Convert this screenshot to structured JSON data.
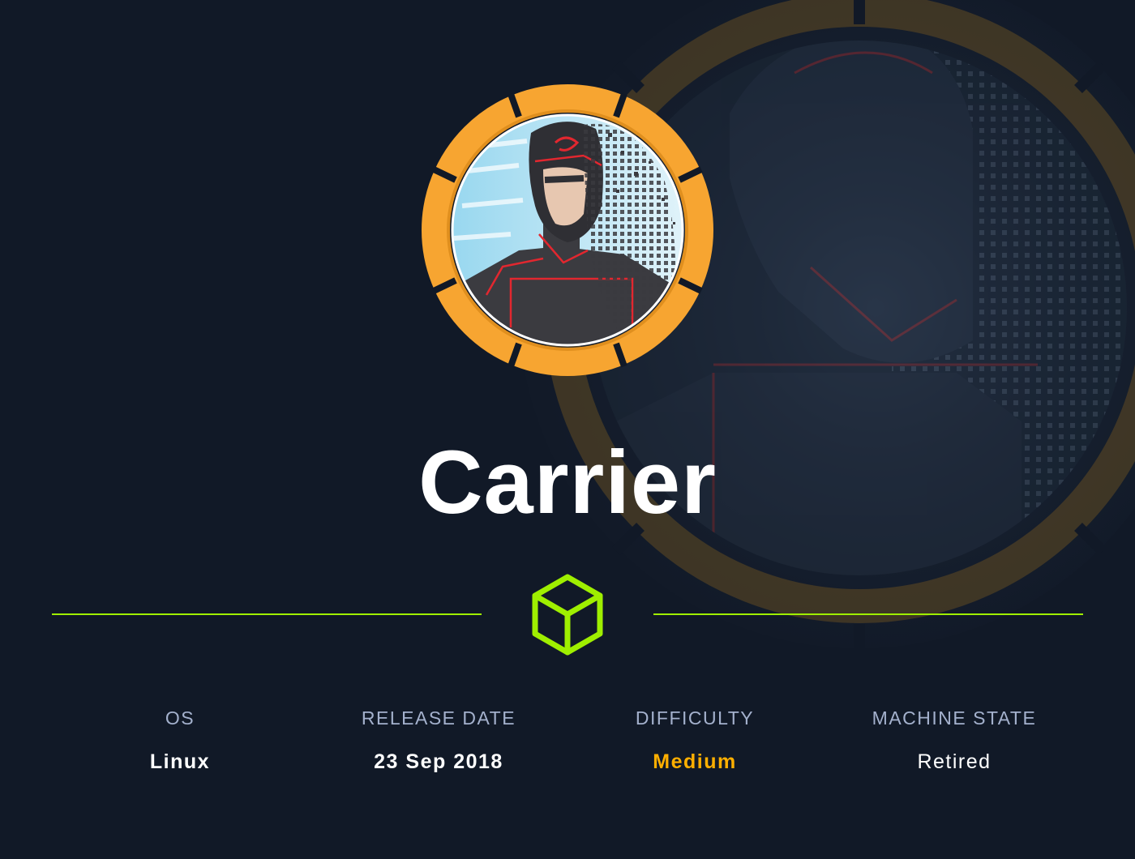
{
  "machine": {
    "name": "Carrier",
    "avatar_icon": "carrier-avatar-icon",
    "emblem_icon": "hackthebox-cube-icon"
  },
  "stats": [
    {
      "label": "OS",
      "value": "Linux"
    },
    {
      "label": "RELEASE DATE",
      "value": "23 Sep 2018"
    },
    {
      "label": "DIFFICULTY",
      "value": "Medium"
    },
    {
      "label": "MACHINE STATE",
      "value": "Retired"
    }
  ],
  "colors": {
    "background": "#111927",
    "accent": "#9fef00",
    "ring": "#f7a531",
    "difficulty": "#ffaf00",
    "label": "#a4b1cd",
    "value": "#ffffff"
  }
}
